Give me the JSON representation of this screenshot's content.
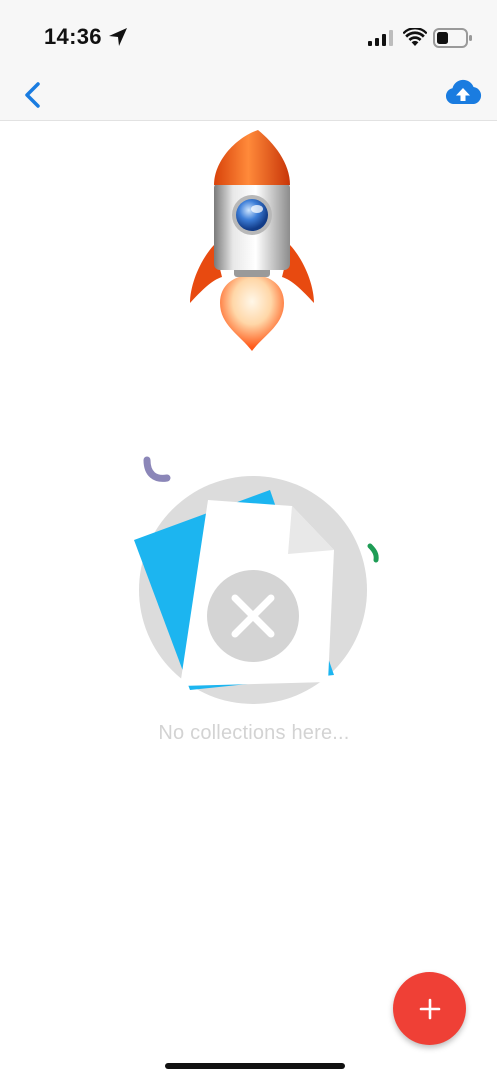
{
  "status_bar": {
    "time": "14:36",
    "icons": [
      "location-arrow-icon",
      "cellular-signal-icon",
      "wifi-icon",
      "battery-icon"
    ]
  },
  "nav_bar": {
    "back_icon": "chevron-left-icon",
    "upload_icon": "cloud-upload-icon"
  },
  "illustrations": {
    "rocket": "rocket-icon",
    "empty_state": "empty-collections-icon"
  },
  "empty_state": {
    "message": "No collections here..."
  },
  "fab": {
    "icon": "plus-icon"
  },
  "colors": {
    "accent_blue": "#1a7ce0",
    "fab_red": "#ef4036",
    "card_blue": "#1cb5f0",
    "muted_text": "#d3d3d3"
  }
}
